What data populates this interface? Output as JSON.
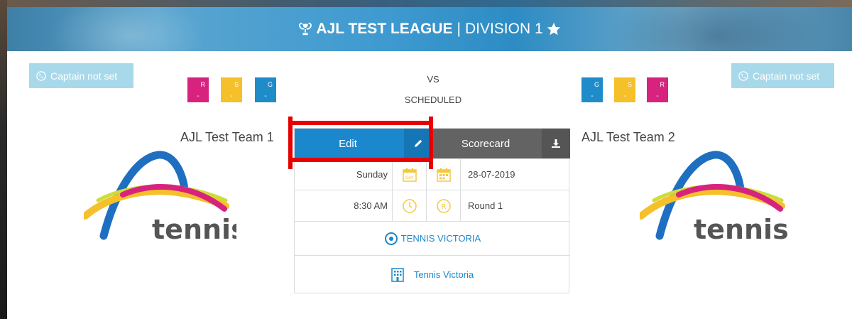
{
  "banner": {
    "league": "AJL TEST LEAGUE",
    "separator": "|",
    "division": "DIVISION 1",
    "icons": [
      "trophy-icon",
      "star-icon"
    ]
  },
  "captains": {
    "left_label": "Captain not set",
    "right_label": "Captain not set",
    "icon": "phone-icon"
  },
  "team1": {
    "name": "AJL Test Team 1",
    "logo_text": "tennis",
    "stats": [
      {
        "key": "R",
        "value": "-",
        "color": "#d7237e"
      },
      {
        "key": "S",
        "value": "-",
        "color": "#f6c02a"
      },
      {
        "key": "G",
        "value": "-",
        "color": "#1f8cc9"
      }
    ]
  },
  "team2": {
    "name": "AJL Test Team 2",
    "logo_text": "tennis",
    "stats": [
      {
        "key": "G",
        "value": "-",
        "color": "#1f8cc9"
      },
      {
        "key": "S",
        "value": "-",
        "color": "#f6c02a"
      },
      {
        "key": "R",
        "value": "-",
        "color": "#d7237e"
      }
    ]
  },
  "match": {
    "vs": "VS",
    "status": "SCHEDULED",
    "edit_label": "Edit",
    "scorecard_label": "Scorecard",
    "day": "Sunday",
    "day_icon_text": "DAY",
    "date": "28-07-2019",
    "time": "8:30 AM",
    "round_icon_text": "R",
    "round": "Round 1",
    "location": "TENNIS VICTORIA",
    "venue": "Tennis Victoria"
  },
  "colors": {
    "accent_blue": "#1b87cc",
    "scorecard_gray": "#636363",
    "captain_bg": "#a8d9ea",
    "highlight_red": "#e60000",
    "icon_yellow": "#f5c842"
  }
}
